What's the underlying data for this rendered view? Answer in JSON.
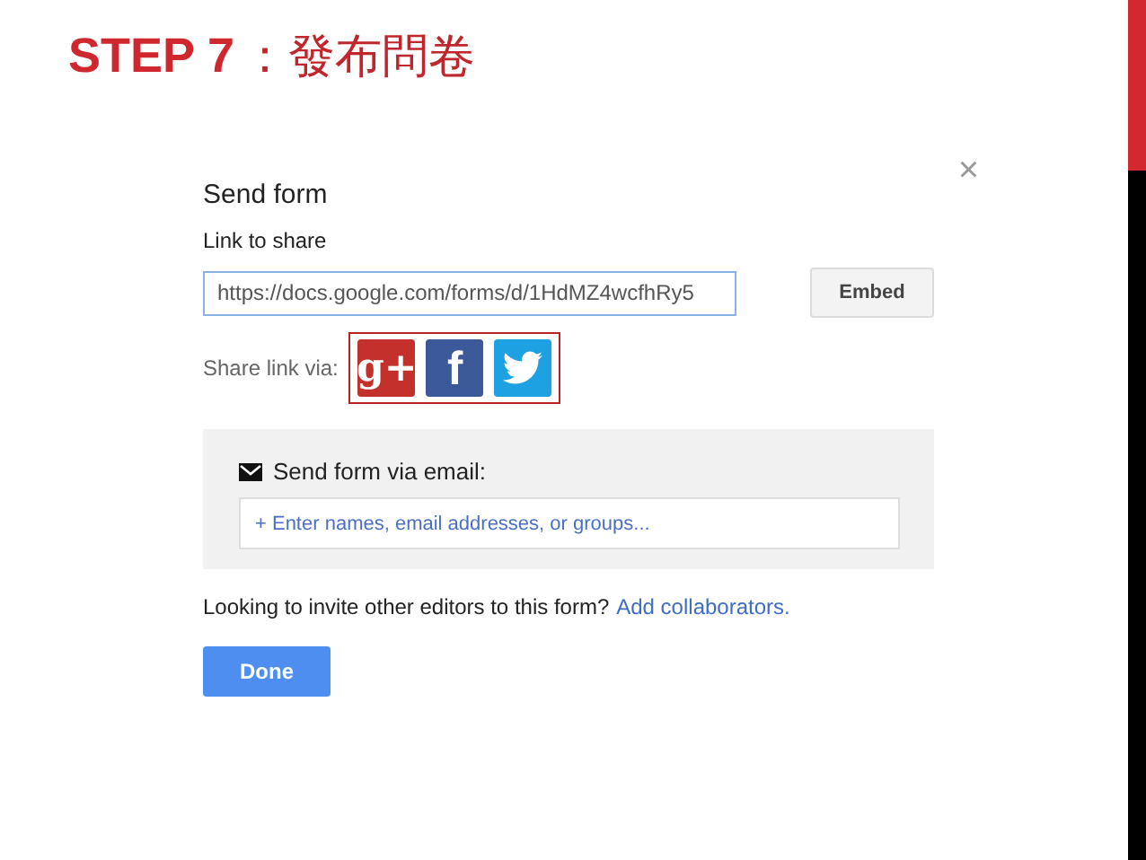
{
  "slide": {
    "step": "STEP 7",
    "title": "：發布問卷"
  },
  "dialog": {
    "title": "Send form",
    "close": "×",
    "link_label": "Link to share",
    "link_value": "https://docs.google.com/forms/d/1HdMZ4wcfhRy5",
    "embed_button": "Embed",
    "share_label": "Share link via:",
    "share_buttons": [
      {
        "kind": "google_plus",
        "glyph": "g+"
      },
      {
        "kind": "facebook",
        "glyph": "f"
      },
      {
        "kind": "twitter"
      }
    ],
    "email_label": "Send form via email:",
    "email_field": {
      "placeholder": "+ Enter names, email addresses, or groups..."
    },
    "invite_text": "Looking to invite other editors to this form?",
    "invite_link": "Add collaborators.",
    "done_button": "Done"
  }
}
